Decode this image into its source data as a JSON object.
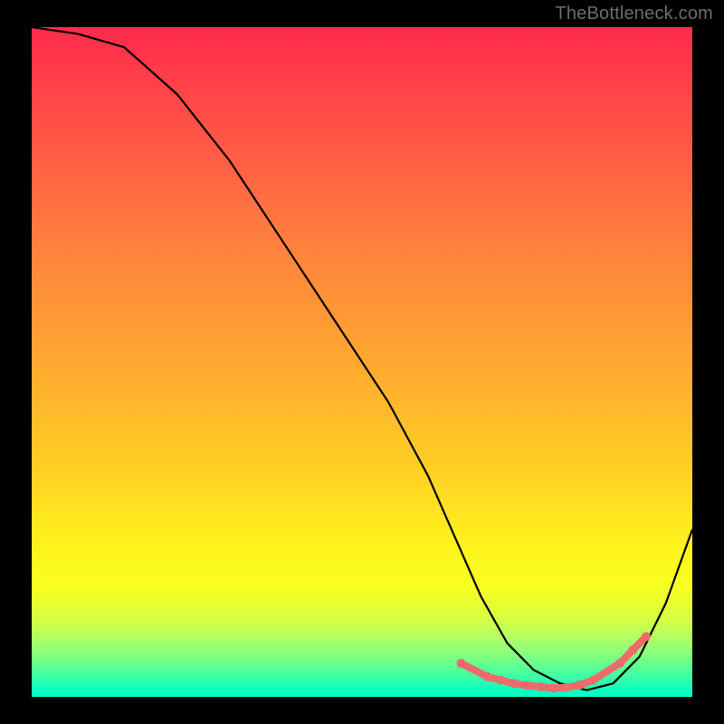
{
  "attribution": "TheBottleneck.com",
  "chart_data": {
    "type": "line",
    "title": "",
    "xlabel": "",
    "ylabel": "",
    "axes_visible": false,
    "xlim": [
      0,
      100
    ],
    "ylim": [
      0,
      100
    ],
    "background_gradient": {
      "top_color": "#ff2a4d",
      "bottom_color": "#00ffc8",
      "meaning": "red at top (high bottleneck), green at bottom (low bottleneck)"
    },
    "series": [
      {
        "name": "bottleneck-curve",
        "color": "#000000",
        "stroke_width": 2,
        "x": [
          0,
          7,
          14,
          22,
          30,
          38,
          46,
          54,
          60,
          64,
          68,
          72,
          76,
          80,
          84,
          88,
          92,
          96,
          100
        ],
        "y": [
          100,
          99,
          97,
          90,
          80,
          68,
          56,
          44,
          33,
          24,
          15,
          8,
          4,
          2,
          1,
          2,
          6,
          14,
          25
        ]
      }
    ],
    "markers": {
      "name": "sweet-spot-markers",
      "color": "#ef6a6a",
      "radius": 5,
      "thick_segment_width": 8,
      "points": [
        {
          "x": 65,
          "y": 5
        },
        {
          "x": 69,
          "y": 3
        },
        {
          "x": 71,
          "y": 2.5
        },
        {
          "x": 73,
          "y": 2
        },
        {
          "x": 75,
          "y": 1.7
        },
        {
          "x": 77,
          "y": 1.5
        },
        {
          "x": 79,
          "y": 1.3
        },
        {
          "x": 81,
          "y": 1.4
        },
        {
          "x": 83,
          "y": 1.8
        },
        {
          "x": 85,
          "y": 2.5
        },
        {
          "x": 89,
          "y": 5
        },
        {
          "x": 91,
          "y": 7
        },
        {
          "x": 93,
          "y": 9
        }
      ]
    }
  }
}
